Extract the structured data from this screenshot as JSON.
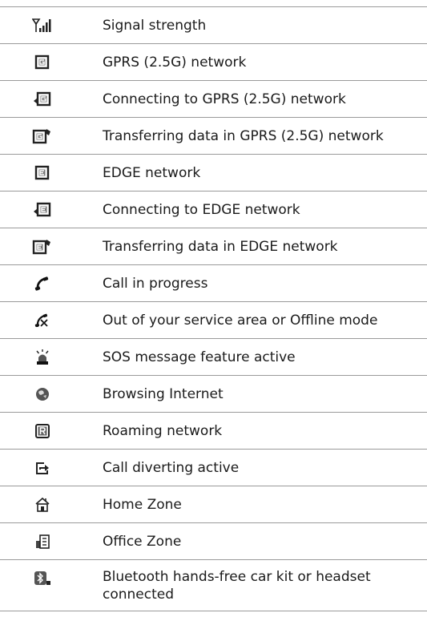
{
  "rows": [
    {
      "icon": "signal-strength-icon",
      "label": "Signal strength"
    },
    {
      "icon": "gprs-network-icon",
      "label": "GPRS (2.5G) network"
    },
    {
      "icon": "gprs-connecting-icon",
      "label": "Connecting to GPRS (2.5G) network"
    },
    {
      "icon": "gprs-transferring-icon",
      "label": "Transferring data in GPRS (2.5G) network"
    },
    {
      "icon": "edge-network-icon",
      "label": "EDGE network"
    },
    {
      "icon": "edge-connecting-icon",
      "label": "Connecting to EDGE network"
    },
    {
      "icon": "edge-transferring-icon",
      "label": "Transferring data in EDGE network"
    },
    {
      "icon": "call-in-progress-icon",
      "label": "Call in progress"
    },
    {
      "icon": "out-of-service-icon",
      "label": "Out of your service area or Offline mode"
    },
    {
      "icon": "sos-icon",
      "label": "SOS message feature active"
    },
    {
      "icon": "globe-icon",
      "label": "Browsing Internet"
    },
    {
      "icon": "roaming-icon",
      "label": "Roaming network"
    },
    {
      "icon": "call-divert-icon",
      "label": "Call diverting active"
    },
    {
      "icon": "home-zone-icon",
      "label": "Home Zone"
    },
    {
      "icon": "office-zone-icon",
      "label": "Office Zone"
    },
    {
      "icon": "bluetooth-car-kit-icon",
      "label": "Bluetooth hands-free car kit or headset connected"
    }
  ]
}
